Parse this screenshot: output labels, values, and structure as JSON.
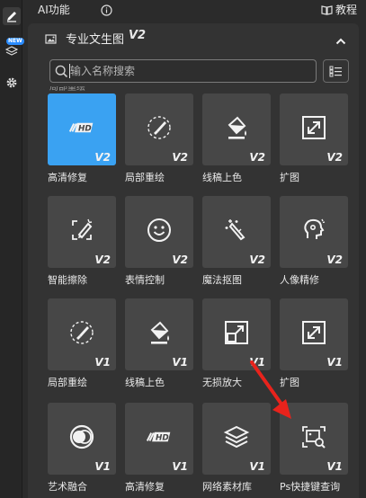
{
  "header": {
    "title": "AI功能",
    "tutorial": "教程"
  },
  "rail": {
    "badge": "NEW"
  },
  "panel": {
    "title": "专业文生图",
    "version": "V2",
    "search_placeholder": "输入名称搜索",
    "cut_label": "局部重绘"
  },
  "tools": [
    {
      "label": "高清修复",
      "version": "V2",
      "icon": "hd-icon"
    },
    {
      "label": "局部重绘",
      "version": "V2",
      "icon": "brush-icon"
    },
    {
      "label": "线稿上色",
      "version": "V2",
      "icon": "paint-bucket-icon"
    },
    {
      "label": "扩图",
      "version": "V2",
      "icon": "expand-icon"
    },
    {
      "label": "智能擦除",
      "version": "V2",
      "icon": "eraser-icon"
    },
    {
      "label": "表情控制",
      "version": "V2",
      "icon": "smile-icon"
    },
    {
      "label": "魔法抠图",
      "version": "V2",
      "icon": "magic-wand-icon"
    },
    {
      "label": "人像精修",
      "version": "V2",
      "icon": "portrait-icon"
    },
    {
      "label": "局部重绘",
      "version": "V1",
      "icon": "brush-icon"
    },
    {
      "label": "线稿上色",
      "version": "V1",
      "icon": "paint-bucket-icon"
    },
    {
      "label": "无损放大",
      "version": "V1",
      "icon": "upscale-icon"
    },
    {
      "label": "扩图",
      "version": "V1",
      "icon": "expand-icon"
    },
    {
      "label": "艺术融合",
      "version": "V1",
      "icon": "blend-icon"
    },
    {
      "label": "高清修复",
      "version": "V1",
      "icon": "hd-icon"
    },
    {
      "label": "网络素材库",
      "version": "V1",
      "icon": "layers-icon"
    },
    {
      "label": "Ps快捷键查询",
      "version": "V1",
      "icon": "image-search-icon"
    }
  ],
  "colors": {
    "accent": "#3aa2f2",
    "arrow": "#e8231c",
    "badge": "#2a8cff"
  }
}
